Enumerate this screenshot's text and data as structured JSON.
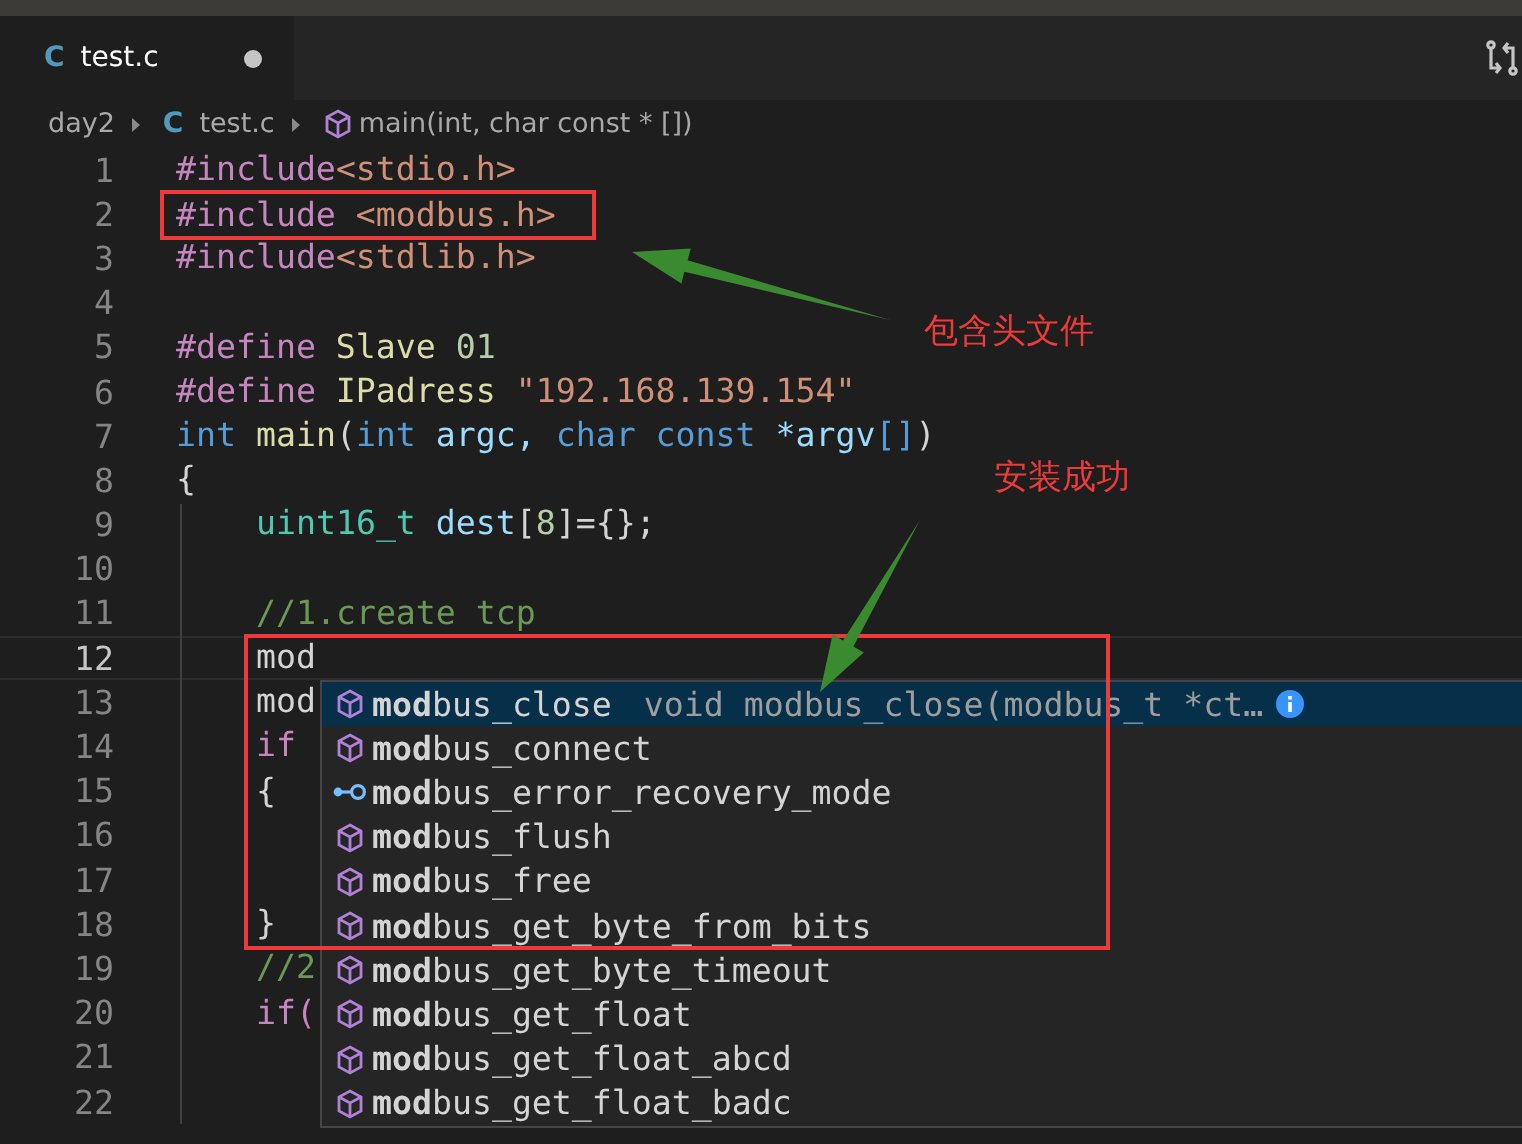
{
  "tab": {
    "icon_letter": "C",
    "label": "test.c",
    "modified": true,
    "selected": true
  },
  "breadcrumb": [
    {
      "kind": "folder",
      "label": "day2"
    },
    {
      "kind": "file",
      "icon_letter": "C",
      "label": "test.c"
    },
    {
      "kind": "symbol",
      "label": "main(int, char const * [])"
    }
  ],
  "lines": [
    {
      "number": "1",
      "indented": false,
      "current": false,
      "tokens": [
        {
          "text": "#include",
          "kind": "directive"
        },
        {
          "text": "<stdio.h>",
          "kind": "string"
        }
      ]
    },
    {
      "number": "2",
      "indented": false,
      "current": false,
      "boxed": true,
      "tokens": [
        {
          "text": "#include",
          "kind": "directive"
        },
        {
          "text": " <modbus.h>",
          "kind": "string"
        }
      ]
    },
    {
      "number": "3",
      "indented": false,
      "current": false,
      "tokens": [
        {
          "text": "#include",
          "kind": "directive"
        },
        {
          "text": "<stdlib.h>",
          "kind": "string"
        }
      ]
    },
    {
      "number": "4",
      "indented": false,
      "current": false
    },
    {
      "number": "5",
      "indented": false,
      "current": false,
      "tokens": [
        {
          "text": "#define",
          "kind": "directive"
        },
        {
          "text": " Slave",
          "kind": "macro"
        },
        {
          "text": " 01",
          "kind": "number"
        }
      ]
    },
    {
      "number": "6",
      "indented": false,
      "current": false,
      "tokens": [
        {
          "text": "#define",
          "kind": "directive"
        },
        {
          "text": " IPadress",
          "kind": "macro"
        },
        {
          "text": " \"192.168.139.154\"",
          "kind": "string"
        }
      ]
    },
    {
      "number": "7",
      "indented": false,
      "current": false,
      "tokens": [
        {
          "text": "int",
          "kind": "keyword"
        },
        {
          "text": " main",
          "kind": "function"
        },
        {
          "text": "(",
          "kind": "plain"
        },
        {
          "text": "int",
          "kind": "keyword"
        },
        {
          "text": " argc, ",
          "kind": "variable"
        },
        {
          "text": "char const",
          "kind": "keyword"
        },
        {
          "text": " *argv",
          "kind": "variable"
        },
        {
          "text": "[]",
          "kind": "keyword"
        },
        {
          "text": ")",
          "kind": "plain"
        }
      ]
    },
    {
      "number": "8",
      "indented": false,
      "current": false,
      "tokens": [
        {
          "text": "{",
          "kind": "plain"
        }
      ]
    },
    {
      "number": "9",
      "indented": true,
      "current": false,
      "tokens": [
        {
          "text": "uint16_t",
          "kind": "type"
        },
        {
          "text": " dest",
          "kind": "variable"
        },
        {
          "text": "[",
          "kind": "plain"
        },
        {
          "text": "8",
          "kind": "number"
        },
        {
          "text": "]={};",
          "kind": "plain"
        }
      ]
    },
    {
      "number": "10",
      "indented": true,
      "current": false
    },
    {
      "number": "11",
      "indented": true,
      "current": false,
      "tokens": [
        {
          "text": "//1.create tcp",
          "kind": "comment"
        }
      ]
    },
    {
      "number": "12",
      "indented": true,
      "current": true,
      "tokens": [
        {
          "text": "mod",
          "kind": "plain"
        }
      ]
    },
    {
      "number": "13",
      "indented": true,
      "current": false,
      "tokens": [
        {
          "text": "mod",
          "kind": "plain"
        }
      ]
    },
    {
      "number": "14",
      "indented": true,
      "current": false,
      "tokens": [
        {
          "text": "if",
          "kind": "directive"
        }
      ]
    },
    {
      "number": "15",
      "indented": true,
      "current": false,
      "tokens": [
        {
          "text": "{",
          "kind": "plain"
        }
      ]
    },
    {
      "number": "16",
      "indented": true,
      "current": false
    },
    {
      "number": "17",
      "indented": true,
      "current": false
    },
    {
      "number": "18",
      "indented": true,
      "current": false,
      "tokens": [
        {
          "text": "}",
          "kind": "plain"
        }
      ]
    },
    {
      "number": "19",
      "indented": true,
      "current": false,
      "tokens": [
        {
          "text": "//2",
          "kind": "comment"
        }
      ]
    },
    {
      "number": "20",
      "indented": true,
      "current": false,
      "tokens": [
        {
          "text": "if(",
          "kind": "directive"
        }
      ]
    },
    {
      "number": "21",
      "indented": true,
      "current": false
    },
    {
      "number": "22",
      "indented": true,
      "current": false
    }
  ],
  "suggestions": [
    {
      "label": "**mod**bus_close",
      "kind": "function",
      "selected": true,
      "detail": "void modbus_close(modbus_t *ct…"
    },
    {
      "label": "**mod**bus_connect",
      "kind": "function",
      "selected": false
    },
    {
      "label": "**mod**bus_error_recovery_mode",
      "kind": "field",
      "selected": false
    },
    {
      "label": "**mod**bus_flush",
      "kind": "function",
      "selected": false
    },
    {
      "label": "**mod**bus_free",
      "kind": "function",
      "selected": false
    },
    {
      "label": "**mod**bus_get_byte_from_bits",
      "kind": "function",
      "selected": false
    },
    {
      "label": "**mod**bus_get_byte_timeout",
      "kind": "function",
      "selected": false
    },
    {
      "label": "**mod**bus_get_float",
      "kind": "function",
      "selected": false
    },
    {
      "label": "**mod**bus_get_float_abcd",
      "kind": "function",
      "selected": false
    },
    {
      "label": "**mod**bus_get_float_badc",
      "kind": "function",
      "selected": false
    }
  ],
  "annotations": [
    {
      "text": "包含头文件"
    },
    {
      "text": "安装成功"
    }
  ]
}
